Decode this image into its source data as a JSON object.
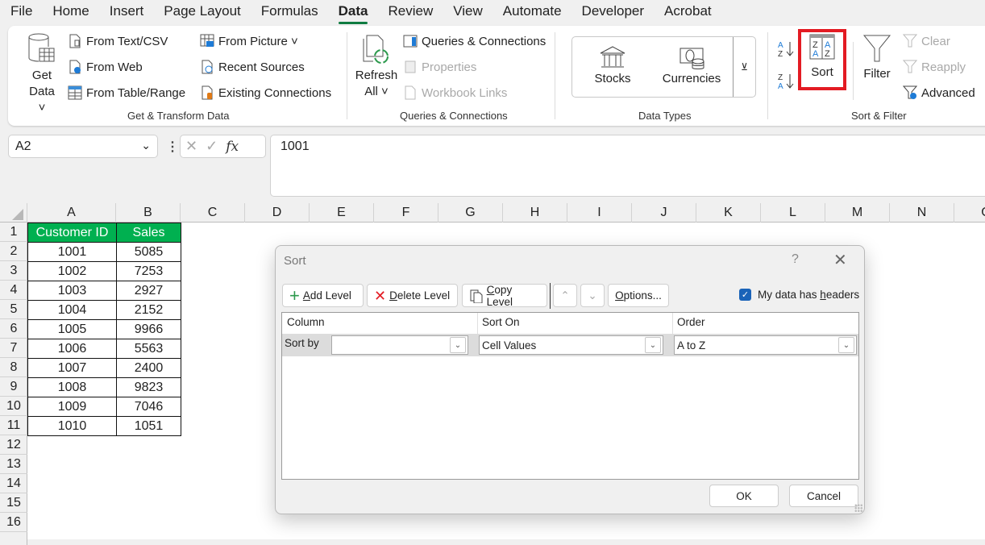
{
  "menu": {
    "tabs": [
      "File",
      "Home",
      "Insert",
      "Page Layout",
      "Formulas",
      "Data",
      "Review",
      "View",
      "Automate",
      "Developer",
      "Acrobat"
    ],
    "active": "Data"
  },
  "ribbon": {
    "get_transform": {
      "label": "Get & Transform Data",
      "get_data": [
        "Get",
        "Data ˅"
      ],
      "from_text_csv": "From Text/CSV",
      "from_web": "From Web",
      "from_table_range": "From Table/Range",
      "from_picture": "From Picture ˅",
      "recent_sources": "Recent Sources",
      "existing_connections": "Existing Connections"
    },
    "queries": {
      "label": "Queries & Connections",
      "refresh_all": [
        "Refresh",
        "All ˅"
      ],
      "queries_connections": "Queries & Connections",
      "properties": "Properties",
      "workbook_links": "Workbook Links"
    },
    "data_types": {
      "label": "Data Types",
      "stocks": "Stocks",
      "currencies": "Currencies"
    },
    "sort_filter": {
      "label": "Sort & Filter",
      "sort": "Sort",
      "filter": "Filter",
      "clear": "Clear",
      "reapply": "Reapply",
      "advanced": "Advanced",
      "highlight_color": "#e31b23"
    }
  },
  "formula_bar": {
    "name_box": "A2",
    "fx": "fx",
    "value": "1001"
  },
  "sheet": {
    "columns": [
      "A",
      "B",
      "C",
      "D",
      "E",
      "F",
      "G",
      "H",
      "I",
      "J",
      "K",
      "L",
      "M",
      "N",
      "O"
    ],
    "rows": [
      "1",
      "2",
      "3",
      "4",
      "5",
      "6",
      "7",
      "8",
      "9",
      "10",
      "11",
      "12",
      "13",
      "14",
      "15",
      "16"
    ],
    "header_color": "#00b050",
    "table": {
      "headers": [
        "Customer ID",
        "Sales"
      ],
      "rows": [
        [
          "1001",
          "5085"
        ],
        [
          "1002",
          "7253"
        ],
        [
          "1003",
          "2927"
        ],
        [
          "1004",
          "2152"
        ],
        [
          "1005",
          "9966"
        ],
        [
          "1006",
          "5563"
        ],
        [
          "1007",
          "2400"
        ],
        [
          "1008",
          "9823"
        ],
        [
          "1009",
          "7046"
        ],
        [
          "1010",
          "1051"
        ]
      ]
    }
  },
  "sort_dialog": {
    "title": "Sort",
    "help": "?",
    "close": "✕",
    "add_level": {
      "u": "A",
      "rest": "dd Level"
    },
    "delete_level": {
      "u": "D",
      "rest": "elete Level"
    },
    "copy_level": {
      "u": "C",
      "rest": "opy Level"
    },
    "options": {
      "u": "O",
      "rest": "ptions..."
    },
    "headers_checkbox": {
      "pre": "My data has ",
      "u": "h",
      "rest": "eaders",
      "checked": true
    },
    "columns": [
      "Column",
      "Sort On",
      "Order"
    ],
    "level": {
      "label": "Sort by",
      "column_value": "",
      "sort_on_value": "Cell Values",
      "order_value": "A to Z"
    },
    "ok": "OK",
    "cancel": "Cancel"
  }
}
